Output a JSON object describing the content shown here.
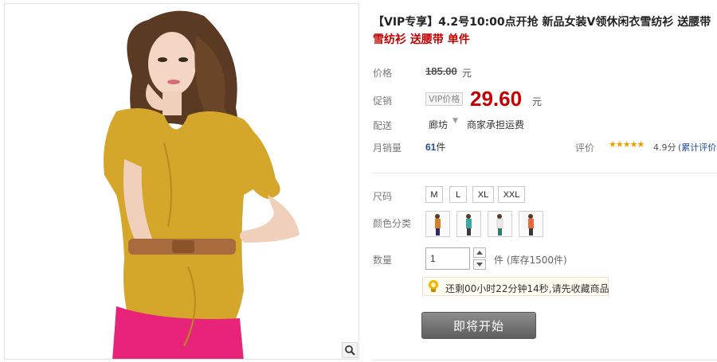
{
  "product": {
    "title_main": "【VIP专享】4.2号10:00点开抢 新品女装V领休闲衣雪纺衫 送腰带",
    "title_sub": "雪纺衫 送腰带 单件"
  },
  "price": {
    "label": "价格",
    "original": "185.00",
    "unit": "元"
  },
  "promo": {
    "label": "促销",
    "tag": "VIP价格",
    "price": "29.60",
    "unit": "元"
  },
  "shipping": {
    "label": "配送",
    "from": "廊坊",
    "note": "商家承担运费"
  },
  "sales": {
    "label": "月销量",
    "count": "61",
    "unit": "件"
  },
  "rating": {
    "label": "评价",
    "stars": "★★★★★",
    "score": "4.9分",
    "link": "(累计评价"
  },
  "sizes": {
    "label": "尺码",
    "options": [
      "M",
      "L",
      "XL",
      "XXL"
    ]
  },
  "colors": {
    "label": "颜色分类"
  },
  "quantity": {
    "label": "数量",
    "value": "1",
    "stock": "件 (库存1500件)"
  },
  "countdown": {
    "text": "还剩00小时22分钟14秒,请先收藏商品"
  },
  "action": {
    "start_label": "即将开始"
  },
  "colors_theme": {
    "price_red": "#c40000",
    "link_blue": "#1e4a9c",
    "dress_mustard": "#d4a62a",
    "skirt_pink": "#e8247a"
  }
}
